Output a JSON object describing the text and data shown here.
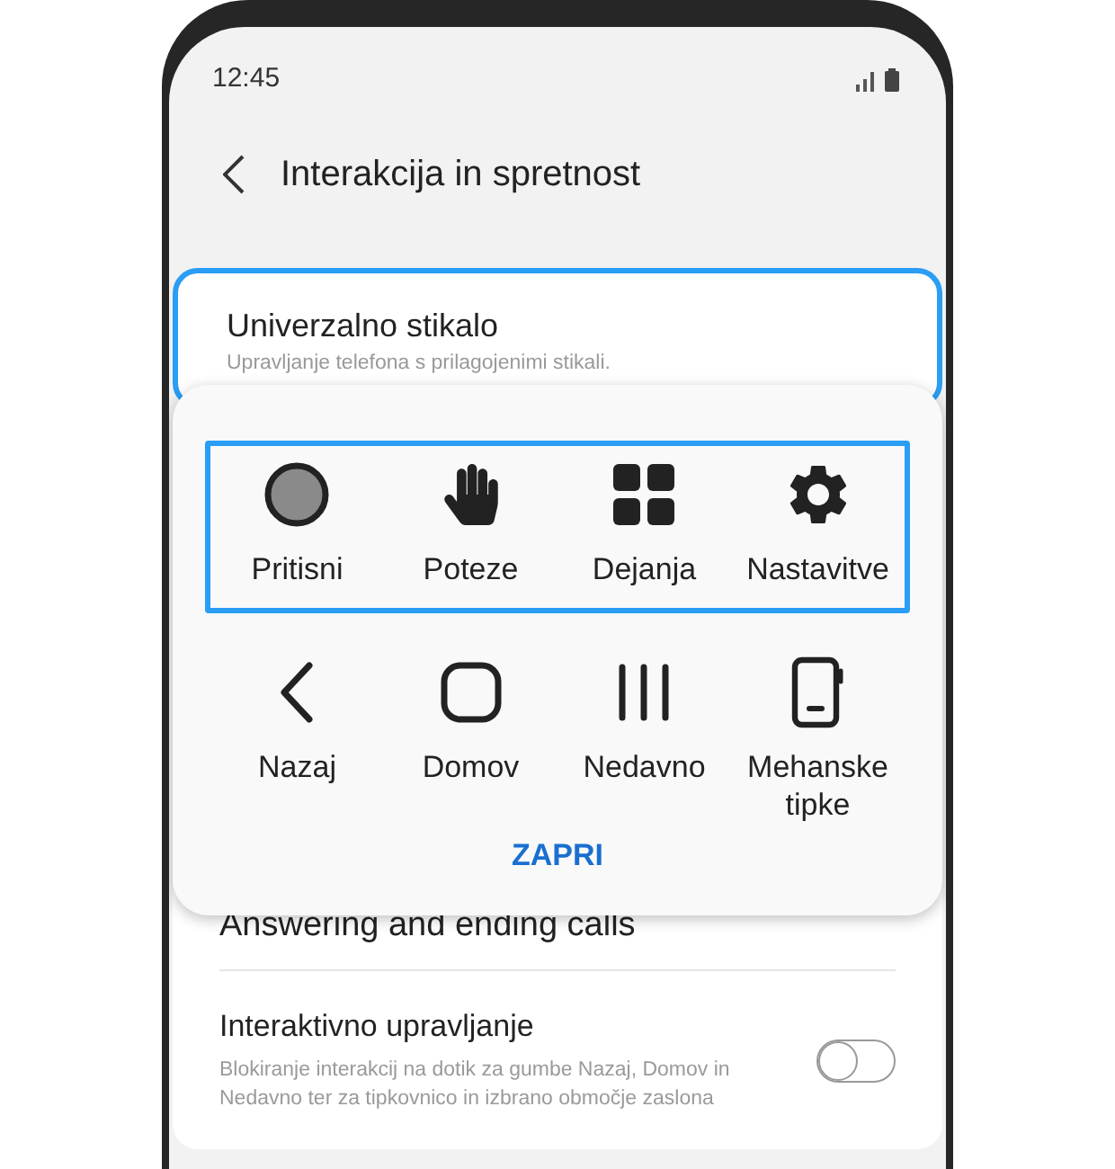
{
  "status_bar": {
    "time": "12:45"
  },
  "header": {
    "title": "Interakcija in spretnost"
  },
  "card": {
    "title": "Univerzalno stikalo",
    "subtitle": "Upravljanje telefona s prilagojenimi stikali.",
    "highlighted": true
  },
  "list": [
    {
      "kind": "plain",
      "title": "Answering and ending calls"
    },
    {
      "kind": "toggle",
      "title": "Interaktivno upravljanje",
      "subtitle": "Blokiranje interakcij na dotik za gumbe Nazaj, Domov in Nedavno ter za tipkovnico in izbrano območje zaslona",
      "on": false
    }
  ],
  "popup": {
    "rows": [
      {
        "highlighted": true,
        "items": [
          {
            "kind": "circle",
            "label": "Pritisni"
          },
          {
            "kind": "hand",
            "label": "Poteze"
          },
          {
            "kind": "grid",
            "label": "Dejanja"
          },
          {
            "kind": "gear",
            "label": "Nastavitve"
          }
        ]
      },
      {
        "highlighted": false,
        "items": [
          {
            "kind": "back",
            "label": "Nazaj"
          },
          {
            "kind": "home",
            "label": "Domov"
          },
          {
            "kind": "recent",
            "label": "Nedavno"
          },
          {
            "kind": "phone",
            "label": "Mehanske tipke"
          }
        ]
      }
    ],
    "close": "ZAPRI"
  }
}
